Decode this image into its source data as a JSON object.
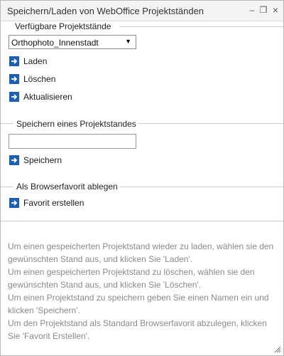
{
  "window": {
    "title": "Speichern/Laden von WebOffice Projektständen",
    "minimize_glyph": "–",
    "restore_glyph": "❐",
    "close_glyph": "×"
  },
  "available": {
    "title": "Verfügbare Projektstände",
    "selected": "Orthophoto_Innenstadt",
    "load_label": "Laden",
    "delete_label": "Löschen",
    "refresh_label": "Aktualisieren"
  },
  "save": {
    "title": "Speichern eines Projektstandes",
    "name_value": "",
    "save_label": "Speichern"
  },
  "favorite": {
    "title": "Als Browserfavorit ablegen",
    "create_label": "Favorit erstellen"
  },
  "help": [
    "Um einen gespeicherten Projektstand wieder zu laden, wählen sie den gewünschten Stand aus, und klicken Sie 'Laden'.",
    "Um einen gespeicherten Projektstand zu löschen, wählen sie den gewünschten Stand aus, und klicken Sie 'Löschen'.",
    "Um einen Projektstand zu speichern geben Sie einen Namen ein und klicken 'Speichern'.",
    "Um den Projektstand als Standard Browserfavorit abzulegen, klicken Sie 'Favorit Erstellen'."
  ],
  "colors": {
    "accent": "#1f5fb3",
    "help_text": "#8a8a8a"
  },
  "icons": {
    "action": "arrow-right-icon",
    "resize": "resize-grip-icon"
  }
}
